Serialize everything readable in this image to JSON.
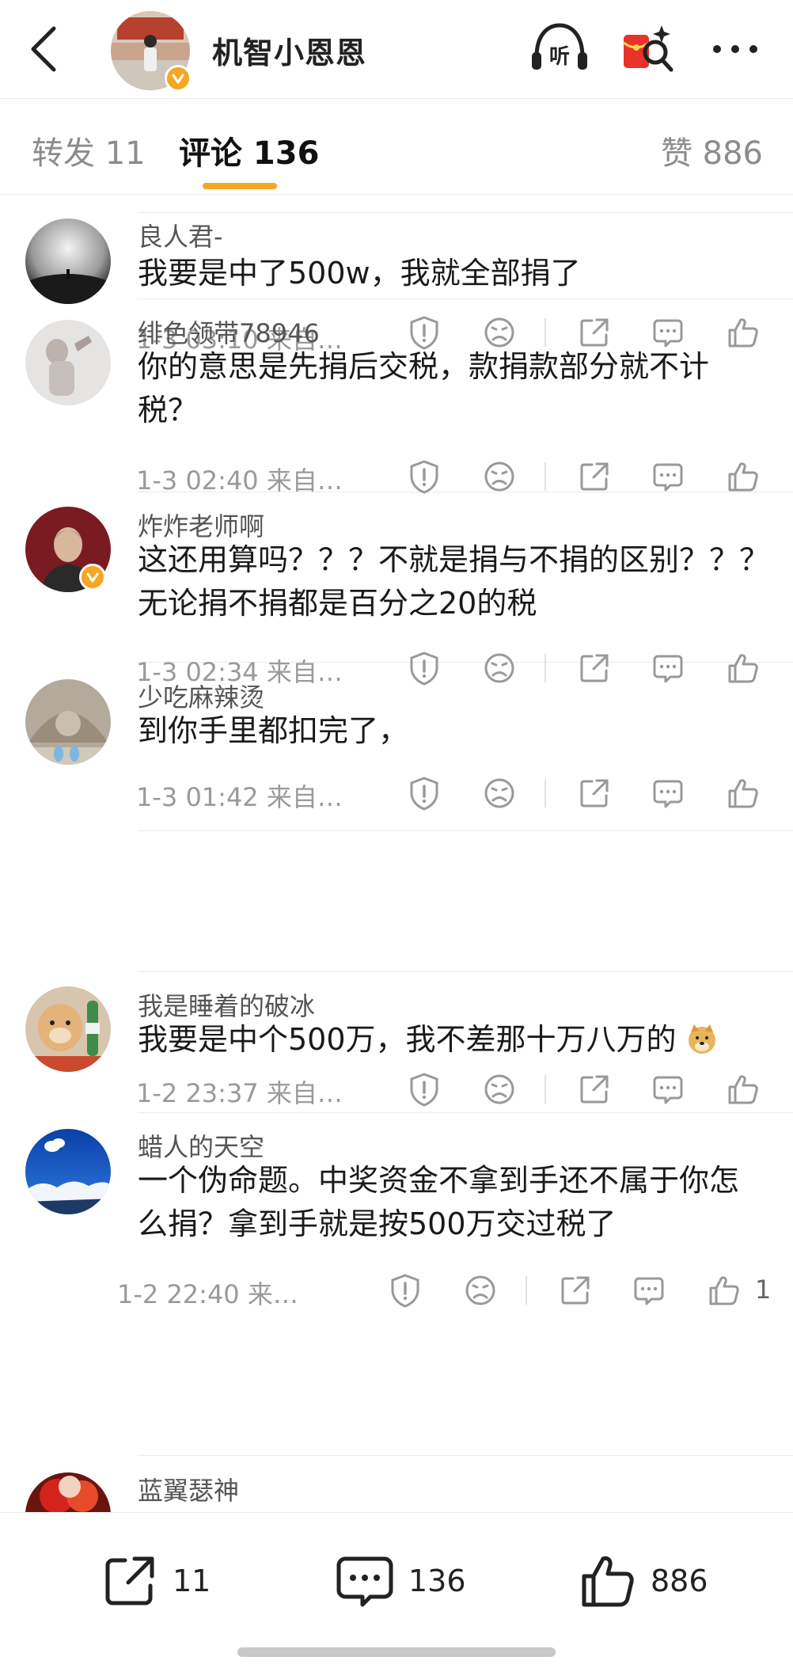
{
  "header": {
    "back_icon": "chevron-left-icon",
    "account_name": "机智小恩恩",
    "listen_label": "听",
    "actions": [
      "listen-icon",
      "red-packet-icon",
      "more-icon"
    ]
  },
  "tabs": {
    "repost": "转发 11",
    "comment": "评论 136",
    "like": "赞 886",
    "active": "comment",
    "accent_color": "#f5a623"
  },
  "comments": [
    {
      "name": "良人君-",
      "text": "我要是中了500w，我就全部捐了",
      "meta": "1-3 03:10  来自…",
      "likes": "",
      "verified": false
    },
    {
      "name": "绯色领带78946",
      "text": "你的意思是先捐后交税，款捐款部分就不计税？",
      "meta": "1-3 02:40  来自…",
      "likes": "",
      "verified": false
    },
    {
      "name": "炸炸老师啊",
      "text": "这还用算吗？？？不就是捐与不捐的区别？？？无论捐不捐都是百分之20的税",
      "meta": "1-3 02:34  来自…",
      "likes": "",
      "verified": true
    },
    {
      "name": "少吃麻辣烫",
      "text": "到你手里都扣完了，",
      "meta": "1-3 01:42  来自…",
      "likes": "",
      "verified": false
    },
    {
      "name": "我是睡着的破冰",
      "text": "我要是中个500万，我不差那十万八万的",
      "meta": "1-2 23:37  来自…",
      "likes": "",
      "verified": false,
      "emoji_icon": "doge-emoji-icon"
    },
    {
      "name": "蜡人的天空",
      "text": "一个伪命题。中奖资金不拿到手还不属于你怎么捐？拿到手就是按500万交过税了",
      "meta": "1-2 22:40  来…",
      "likes": "1",
      "verified": false
    },
    {
      "name": "蓝翼瑟神",
      "text": "",
      "meta": "",
      "likes": "",
      "verified": false
    }
  ],
  "bottom_bar": {
    "repost_count": "11",
    "comment_count": "136",
    "like_count": "886"
  }
}
